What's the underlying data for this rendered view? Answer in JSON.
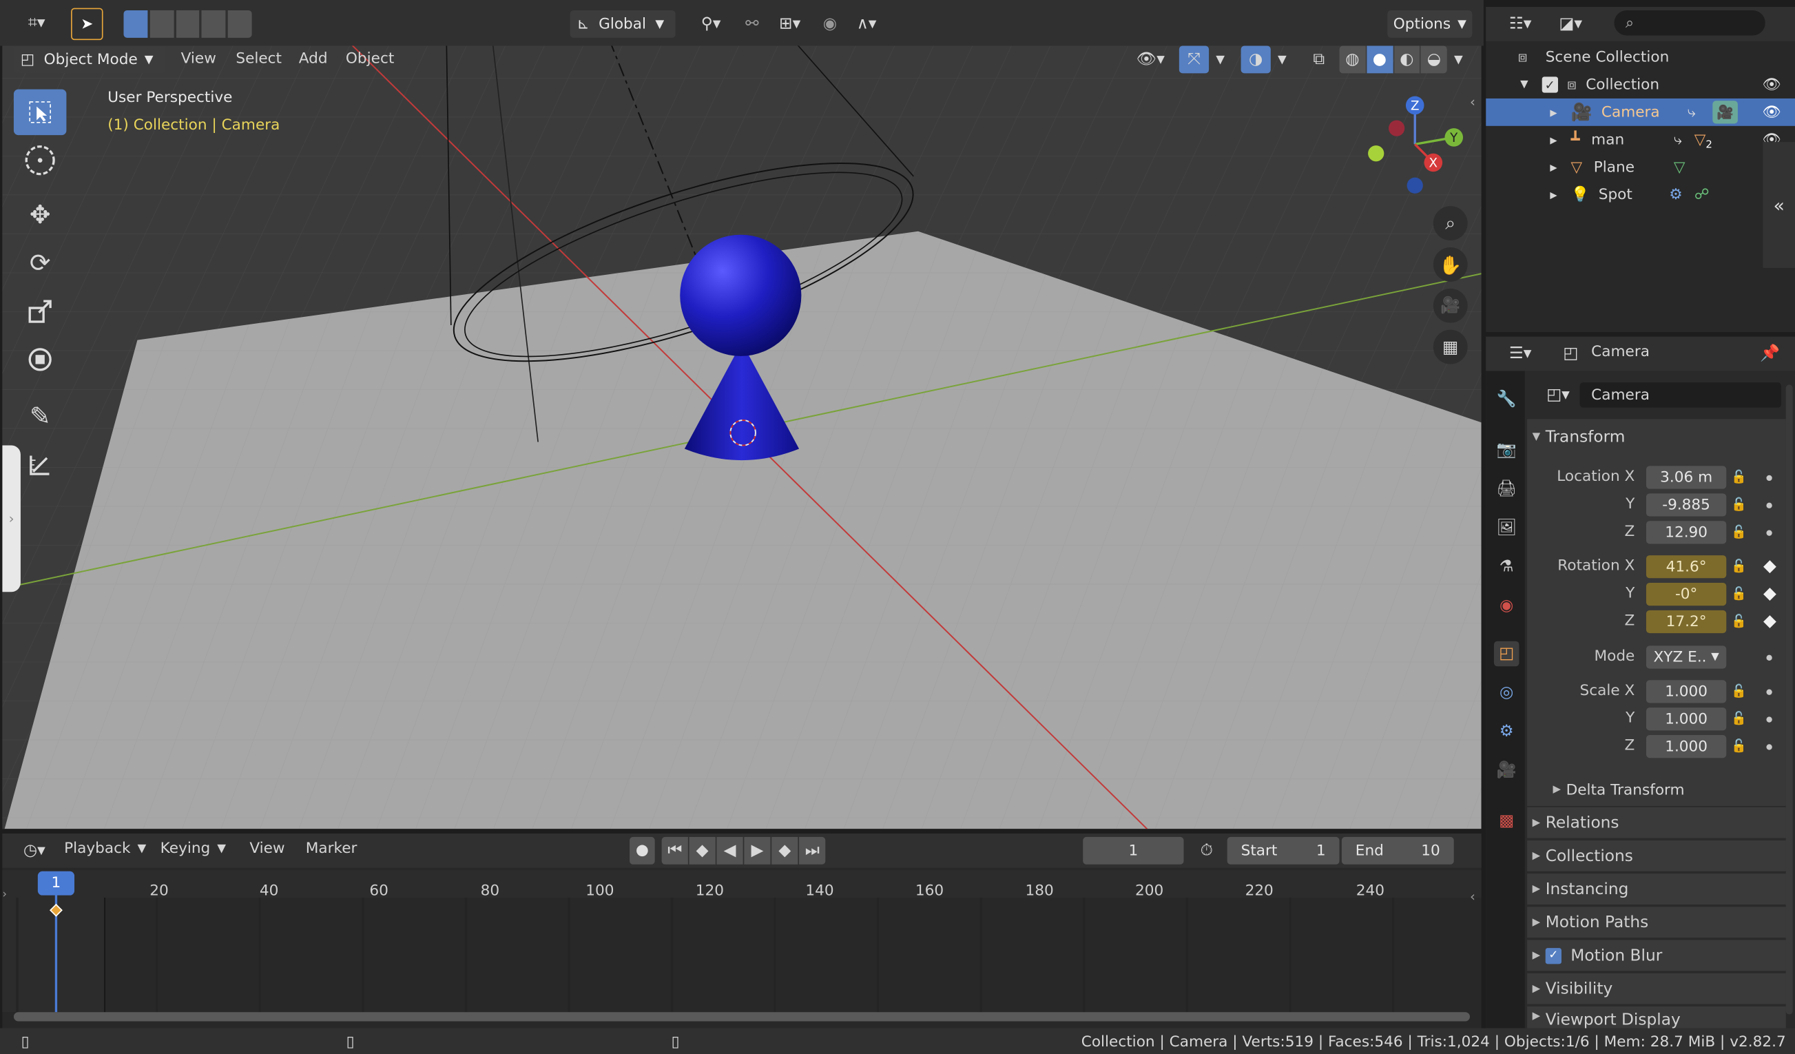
{
  "header": {
    "mode_label": "Object Mode",
    "menus": [
      "View",
      "Select",
      "Add",
      "Object"
    ],
    "orientation": "Global",
    "options_label": "Options"
  },
  "viewport": {
    "overlay_title": "User Perspective",
    "overlay_subtitle": "(1) Collection | Camera",
    "gizmo_axes": [
      "Z",
      "Y",
      "X"
    ],
    "colors": {
      "grid_red": "#c33a3a",
      "grid_green": "#7aa33a",
      "object_blue": "#1a1ab4",
      "floor": "#a5a5a5",
      "bg": "#3a3a3a"
    }
  },
  "outliner": {
    "scene_collection": "Scene Collection",
    "collection": "Collection",
    "items": [
      {
        "label": "Camera",
        "selected": true
      },
      {
        "label": "man",
        "selected": false
      },
      {
        "label": "Plane",
        "selected": false
      },
      {
        "label": "Spot",
        "selected": false
      }
    ],
    "man_badge": "2"
  },
  "properties": {
    "header_title": "Camera",
    "object_name": "Camera",
    "transform_label": "Transform",
    "location": {
      "label_x": "Location X",
      "label_y": "Y",
      "label_z": "Z",
      "x": "3.06 m",
      "y": "-9.885",
      "z": "12.90"
    },
    "rotation": {
      "label_x": "Rotation X",
      "label_y": "Y",
      "label_z": "Z",
      "x": "41.6°",
      "y": "-0°",
      "z": "17.2°"
    },
    "mode": {
      "label": "Mode",
      "value": "XYZ E.."
    },
    "scale": {
      "label_x": "Scale X",
      "label_y": "Y",
      "label_z": "Z",
      "x": "1.000",
      "y": "1.000",
      "z": "1.000"
    },
    "delta_transform": "Delta Transform",
    "sections": [
      "Relations",
      "Collections",
      "Instancing",
      "Motion Paths",
      "Motion Blur",
      "Visibility",
      "Viewport Display"
    ]
  },
  "timeline": {
    "menus": [
      "Playback",
      "Keying",
      "View",
      "Marker"
    ],
    "current_frame": "1",
    "start_label": "Start",
    "start_value": "1",
    "end_label": "End",
    "end_value": "10",
    "playhead_label": "1",
    "ticks": [
      "20",
      "40",
      "60",
      "80",
      "100",
      "120",
      "140",
      "160",
      "180",
      "200",
      "220",
      "240"
    ]
  },
  "status_bar": {
    "text": "Collection | Camera | Verts:519 | Faces:546 | Tris:1,024 | Objects:1/6 | Mem: 28.7 MiB | v2.82.7"
  }
}
